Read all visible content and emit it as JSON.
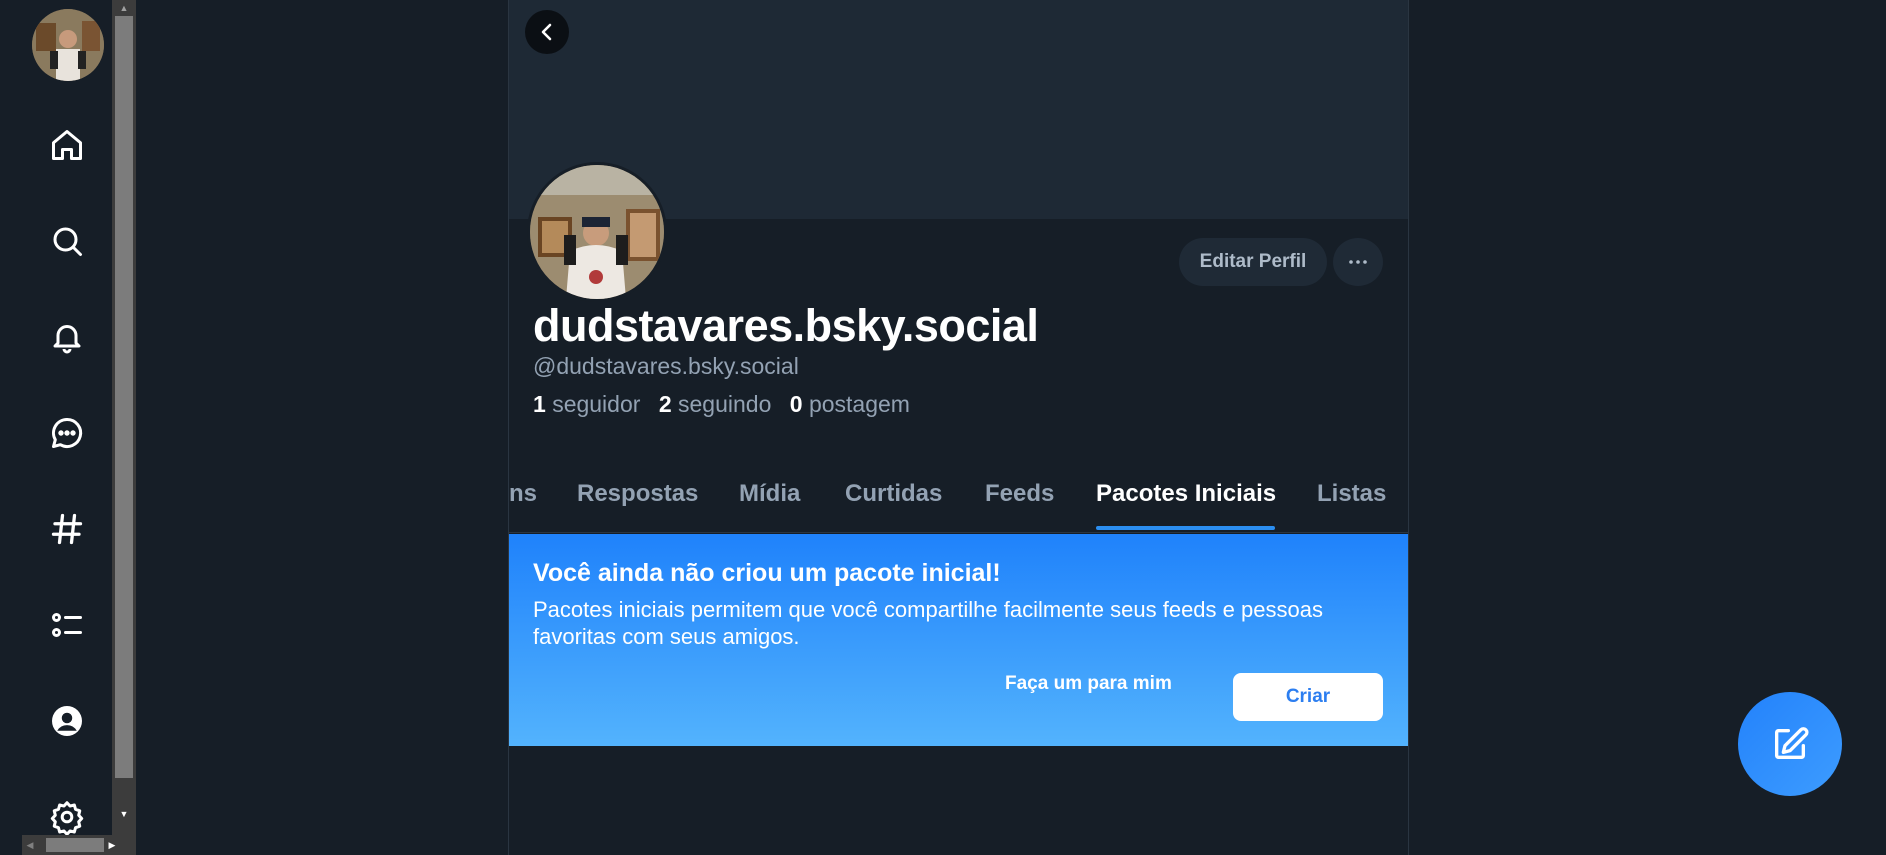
{
  "profile": {
    "display_name": "dudstavares.bsky.social",
    "handle": "@dudstavares.bsky.social",
    "followers_count": "1",
    "followers_label": "seguidor",
    "following_count": "2",
    "following_label": "seguindo",
    "posts_count": "0",
    "posts_label": "postagem",
    "edit_label": "Editar Perfil"
  },
  "tabs": [
    {
      "label": "ns"
    },
    {
      "label": "Respostas"
    },
    {
      "label": "Mídia"
    },
    {
      "label": "Curtidas"
    },
    {
      "label": "Feeds"
    },
    {
      "label": "Pacotes Iniciais",
      "active": true
    },
    {
      "label": "Listas"
    }
  ],
  "starter_pack_card": {
    "title": "Você ainda não criou um pacote inicial!",
    "text": "Pacotes iniciais permitem que você compartilhe facilmente seus feeds e pessoas favoritas com seus amigos.",
    "make_for_me_label": "Faça um para mim",
    "create_label": "Criar"
  },
  "nav_icons": [
    "home-icon",
    "search-icon",
    "bell-icon",
    "chat-icon",
    "hashtag-icon",
    "list-icon",
    "profile-icon",
    "settings-icon"
  ],
  "colors": {
    "background": "#161e27",
    "accent": "#2b8ef0",
    "card_gradient_start": "#1f82fb",
    "card_gradient_end": "#53b3fd"
  }
}
